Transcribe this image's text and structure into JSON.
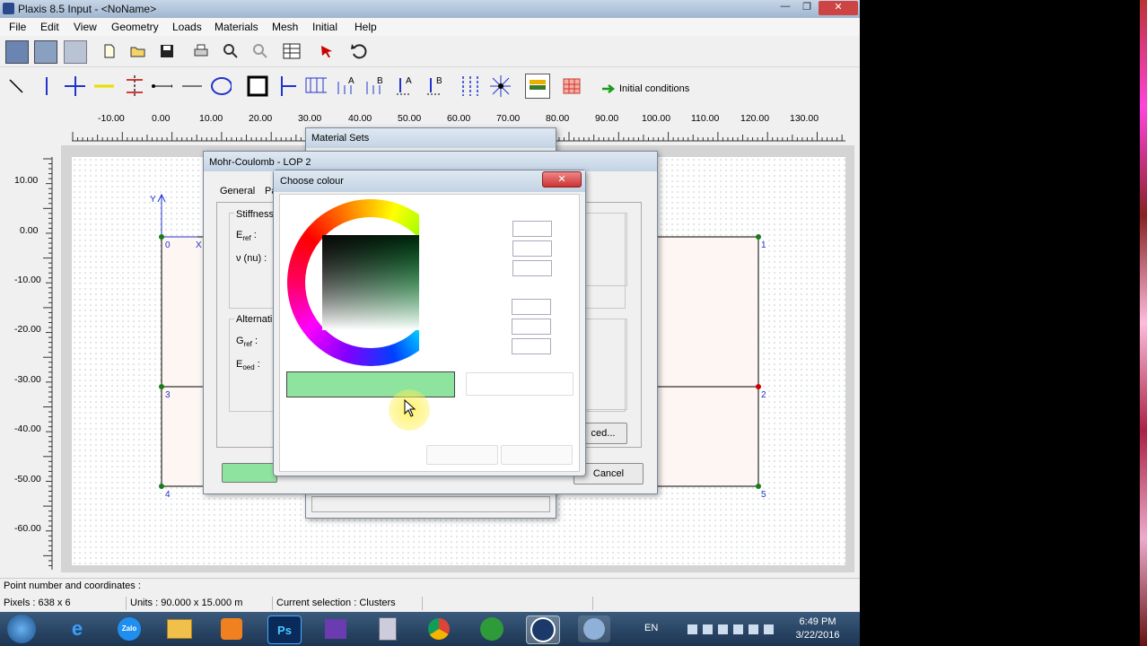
{
  "window": {
    "title": "Plaxis 8.5 Input - <NoName>"
  },
  "menu": [
    "File",
    "Edit",
    "View",
    "Geometry",
    "Loads",
    "Materials",
    "Mesh",
    "Initial",
    "Help"
  ],
  "toolbar": {
    "initial_conditions_label": "Initial conditions"
  },
  "ruler": {
    "x_ticks": [
      "-10.00",
      "0.00",
      "10.00",
      "20.00",
      "30.00",
      "40.00",
      "50.00",
      "60.00",
      "70.00",
      "80.00",
      "90.00",
      "100.00",
      "110.00",
      "120.00",
      "130.00"
    ],
    "y_ticks": [
      "10.00",
      "0.00",
      "-10.00",
      "-20.00",
      "-30.00",
      "-40.00",
      "-50.00",
      "-60.00"
    ]
  },
  "geometry": {
    "axis_y": "Y",
    "axis_x": "X",
    "points": [
      "0",
      "1",
      "2",
      "3",
      "4",
      "5"
    ]
  },
  "material_sets": {
    "title": "Material Sets"
  },
  "mohr_coulomb": {
    "title": "Mohr-Coulomb - LOP 2",
    "tab_general": "General",
    "tab_parameters": "Pa",
    "stiffness_label": "Stiffness",
    "eref_label": "E",
    "eref_sub": "ref",
    "nu_label": "ν (nu) :",
    "alternatives_label": "Alternati",
    "gref_label": "G",
    "gref_sub": "ref",
    "eoed_label": "E",
    "eoed_sub": "oed",
    "advanced_label": "ced...",
    "cancel_label": "Cancel"
  },
  "choose_colour": {
    "title": "Choose colour",
    "selected_colour": "#8ee39e"
  },
  "status": {
    "message": "Point number and coordinates :",
    "pixels": "Pixels : 638 x 6",
    "units": "Units  : 90.000 x 15.000 m",
    "selection": "Current selection : Clusters"
  },
  "taskbar": {
    "apps": [
      "Start",
      "Internet Explorer",
      "Zalo",
      "Explorer",
      "Media",
      "Photoshop",
      "Visual Studio",
      "Calculator",
      "Chrome",
      "Tool",
      "Plaxis",
      "Plaxis Curves"
    ],
    "language": "EN",
    "time": "6:49 PM",
    "date": "3/22/2016"
  }
}
